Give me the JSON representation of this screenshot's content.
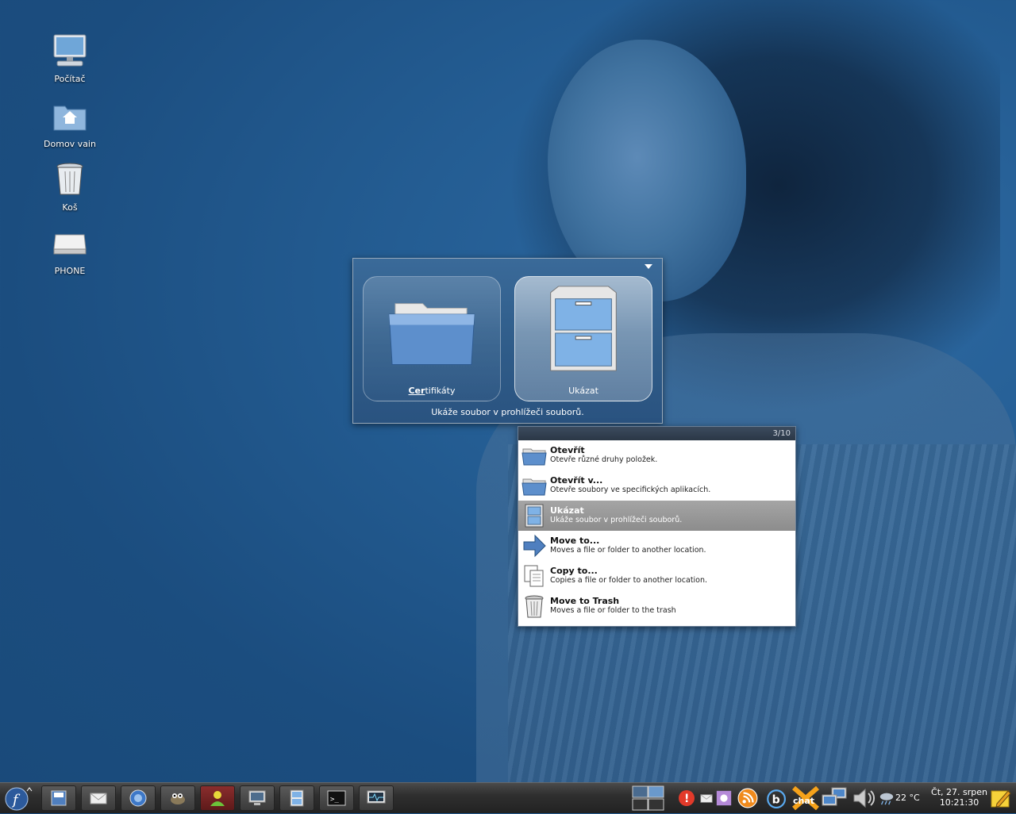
{
  "desktop": {
    "icons": [
      {
        "label": "Počítač",
        "icon": "computer-icon"
      },
      {
        "label": "Domov vain",
        "icon": "home-folder-icon"
      },
      {
        "label": "Koš",
        "icon": "trash-icon"
      },
      {
        "label": "PHONE",
        "icon": "drive-icon"
      }
    ]
  },
  "launcher": {
    "tiles": [
      {
        "label_prefix": "Cer",
        "label_rest": "tifikáty",
        "icon": "folder-icon"
      },
      {
        "label": "Ukázat",
        "icon": "file-cabinet-icon"
      }
    ],
    "description": "Ukáže soubor v prohlížeči souborů."
  },
  "actions": {
    "counter": "3/10",
    "items": [
      {
        "title": "Otevřít",
        "desc": "Otevře různé druhy položek.",
        "icon": "folder-open-icon"
      },
      {
        "title": "Otevřít v...",
        "desc": "Otevře soubory ve specifických aplikacích.",
        "icon": "folder-open-icon"
      },
      {
        "title": "Ukázat",
        "desc": "Ukáže soubor v prohlížeči souborů.",
        "icon": "file-cabinet-icon"
      },
      {
        "title": "Move to...",
        "desc": "Moves a file or folder to another location.",
        "icon": "arrow-right-icon"
      },
      {
        "title": "Copy to...",
        "desc": "Copies a file or folder to another location.",
        "icon": "copy-icon"
      },
      {
        "title": "Move to Trash",
        "desc": "Moves a file or folder to the trash",
        "icon": "trash-icon"
      }
    ],
    "selected_index": 2
  },
  "taskbar": {
    "launchers": [
      "fedora-menu-icon",
      "file-manager-icon",
      "mail-icon",
      "browser-icon",
      "gimp-icon",
      "contacts-icon",
      "display-settings-icon",
      "file-cabinet-icon",
      "terminal-icon",
      "system-monitor-icon"
    ],
    "tray": [
      "workspace-switcher-icon",
      "alert-icon",
      "mail-tray-icon",
      "flower-icon",
      "rss-icon",
      "blogger-icon",
      "chat-icon",
      "network-icon",
      "volume-icon",
      "weather-icon"
    ],
    "temperature": "22 °C",
    "clock_date": "Čt, 27. srpen",
    "clock_time": "10:21:30"
  }
}
